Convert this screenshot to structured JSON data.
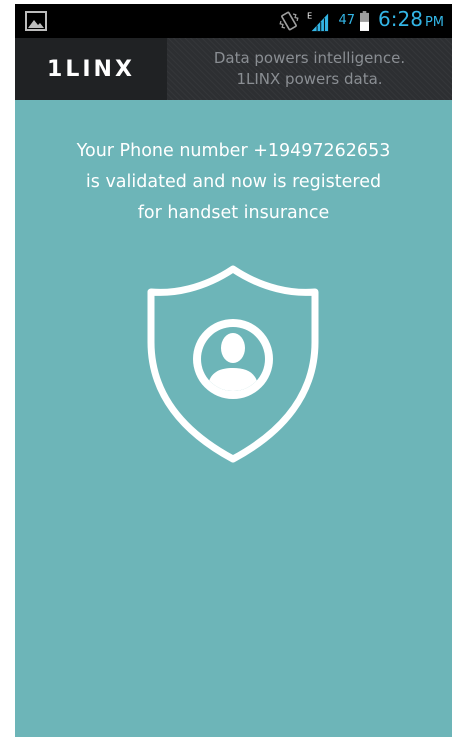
{
  "status_bar": {
    "left_icon": "gallery-notification-icon",
    "right_icons": [
      "vibrate-icon",
      "signal-edge-icon",
      "battery-icon"
    ],
    "network_type": "E",
    "battery_percent": "47",
    "time": "6:28",
    "ampm": "PM",
    "accent_color": "#33b5e5"
  },
  "header": {
    "logo": "1LINX",
    "tagline_line1": "Data powers intelligence.",
    "tagline_line2": "1LINX powers data."
  },
  "main": {
    "background_color": "#6db5b8",
    "message_line1": "Your Phone number +19497262653",
    "message_line2": "is validated and now is registered",
    "message_line3": "for handset insurance",
    "graphic_icon": "shield-user-icon"
  }
}
